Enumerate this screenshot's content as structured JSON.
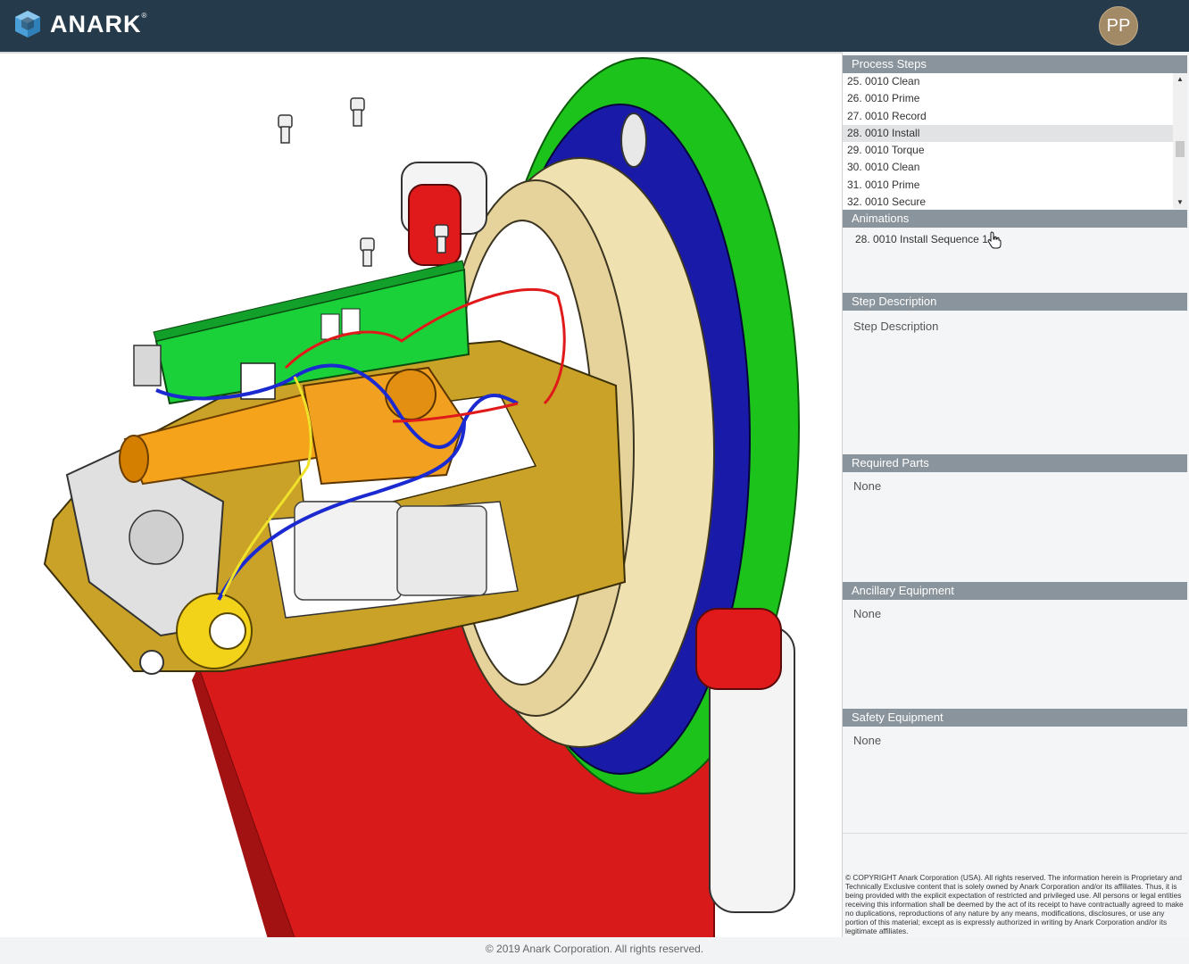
{
  "header": {
    "brand": "ANARK",
    "brand_mark": "®",
    "avatar_initials": "PP"
  },
  "process_steps": {
    "title": "Process Steps",
    "items": [
      "25. 0010 Clean",
      "26. 0010 Prime",
      "27. 0010 Record",
      "28. 0010 Install",
      "29. 0010 Torque",
      "30. 0010 Clean",
      "31. 0010 Prime",
      "32. 0010 Secure"
    ],
    "selected_index": 3
  },
  "animations": {
    "title": "Animations",
    "item": "28. 0010 Install Sequence 1"
  },
  "step_description": {
    "title": "Step Description",
    "text": "Step Description"
  },
  "required_parts": {
    "title": "Required Parts",
    "text": "None"
  },
  "ancillary_equipment": {
    "title": "Ancillary Equipment",
    "text": "None"
  },
  "safety_equipment": {
    "title": "Safety Equipment",
    "text": "None"
  },
  "legal": {
    "copyright_notice": "© COPYRIGHT Anark Corporation (USA). All rights reserved. The information herein is Proprietary and Technically Exclusive content that is solely owned by Anark Corporation and/or its affiliates. Thus, it is being provided with the explicit expectation of restricted and privileged use. All persons or legal entities receiving this information shall be deemed by the act of its receipt to have contractually agreed to make no duplications, reproductions of any nature by any means, modifications, disclosures, or use any portion of this material; except as is expressly authorized in writing by Anark Corporation and/or its legitimate affiliates."
  },
  "footer": {
    "text": "© 2019 Anark Corporation. All rights reserved."
  },
  "colors": {
    "header_bg": "#253a4a",
    "section_header_bg": "#8a949c",
    "avatar_bg": "#a38a66"
  }
}
